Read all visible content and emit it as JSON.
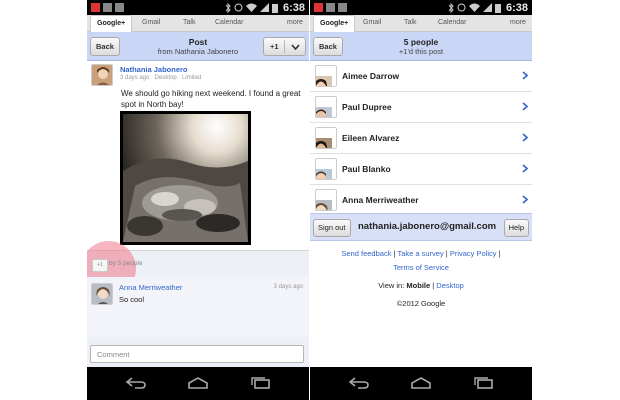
{
  "status_bar": {
    "time": "6:38"
  },
  "tabs": [
    "Google+",
    "Gmail",
    "Talk",
    "Calendar",
    "more"
  ],
  "left": {
    "back_label": "Back",
    "header_title": "Post",
    "header_subtitle": "from Nathania Jabonero",
    "plusone_label": "+1",
    "post": {
      "author": "Nathania Jabonero",
      "meta": "3 days ago · Desktop · Limited",
      "text": "We should go hiking next weekend. I found a great spot in North bay!"
    },
    "plus_count_text": "by 5 people",
    "plus_button": "+1",
    "comment": {
      "author": "Anna Merriweather",
      "time": "3 days ago",
      "text": "So cool"
    },
    "comment_placeholder": "Comment"
  },
  "right": {
    "back_label": "Back",
    "header_title": "5 people",
    "header_subtitle": "+1'd this post",
    "people": [
      "Aimee Darrow",
      "Paul Dupree",
      "Eileen Alvarez",
      "Paul Blanko",
      "Anna Merriweather"
    ],
    "signout_label": "Sign out",
    "email": "nathania.jabonero@gmail.com",
    "help_label": "Help",
    "footer": {
      "send_feedback": "Send feedback",
      "take_survey": "Take a survey",
      "privacy": "Privacy Policy",
      "terms": "Terms of Service",
      "view_in": "View in:",
      "mobile": "Mobile",
      "desktop": "Desktop",
      "copyright": "©2012 Google"
    }
  },
  "colors": {
    "link": "#3366cc",
    "header": "#c9d6f5",
    "account_bar": "#d7e0f6",
    "highlight": "#f0788c"
  }
}
